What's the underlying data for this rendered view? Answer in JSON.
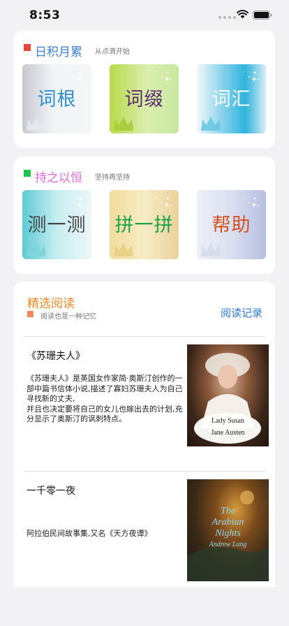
{
  "status_bar": {
    "time": "8:53"
  },
  "section_accumulate": {
    "title": "日积月累",
    "subtitle": "从点滴开始",
    "marker_color": "#e9443d",
    "title_color": "#3d82d6",
    "tiles": [
      {
        "label": "词根",
        "color": "#2c8fd2"
      },
      {
        "label": "词缀",
        "color": "#5b2c6d"
      },
      {
        "label": "词汇",
        "color": "#ffffff"
      }
    ]
  },
  "section_persist": {
    "title": "持之以恒",
    "subtitle": "坚持再坚持",
    "marker_color": "#1fc34a",
    "title_color": "#e56be0",
    "tiles": [
      {
        "label": "测一测",
        "color": "#444444"
      },
      {
        "label": "拼一拼",
        "color": "#1aa34a"
      },
      {
        "label": "帮助",
        "color": "#d4501e"
      }
    ]
  },
  "reading": {
    "title": "精选阅读",
    "subtitle": "阅读也是一种记忆",
    "record_link": "阅读记录",
    "books": [
      {
        "title": "《苏珊夫人》",
        "description": "《苏珊夫人》是英国女作家简·奥斯汀创作的一部中篇书信体小说,描述了寡妇苏珊夫人为自己寻找新的丈夫,\n并且也决定要将自己的女儿也嫁出去的计划,充分显示了奥斯汀的讽刺特点。",
        "cover_text_1": "Lady Susan",
        "cover_text_2": "Jane Austen"
      },
      {
        "title": "一千零一夜",
        "description": "阿拉伯民间故事集,又名《天方夜谭》",
        "cover_text_1": "The",
        "cover_text_2": "Arabian",
        "cover_text_3": "Nights",
        "cover_text_4": "Andrew Lang"
      }
    ]
  }
}
